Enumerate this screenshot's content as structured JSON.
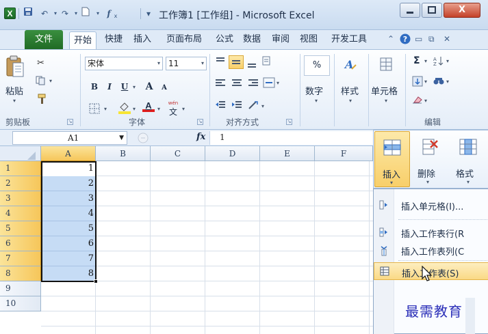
{
  "window": {
    "title": "工作簿1 [工作组] - Microsoft Excel",
    "close_glyph": "X"
  },
  "qat": {
    "app_icon": "X"
  },
  "tabs": [
    {
      "label": "文件"
    },
    {
      "label": "开始"
    },
    {
      "label": "快捷"
    },
    {
      "label": "插入"
    },
    {
      "label": "页面布局"
    },
    {
      "label": "公式"
    },
    {
      "label": "数据"
    },
    {
      "label": "审阅"
    },
    {
      "label": "视图"
    },
    {
      "label": "开发工具"
    }
  ],
  "ribbon": {
    "clipboard": {
      "paste_label": "粘贴",
      "group_label": "剪贴板"
    },
    "font": {
      "font_name": "宋体",
      "font_size": "11",
      "bold": "B",
      "italic": "I",
      "underline": "U",
      "grow": "A",
      "shrink": "A",
      "font_color_glyph": "A",
      "phonetic_glyph": "文",
      "group_label": "字体"
    },
    "alignment": {
      "group_label": "对齐方式"
    },
    "number": {
      "label": "数字"
    },
    "styles": {
      "label": "样式"
    },
    "cells": {
      "label": "单元格"
    },
    "editing": {
      "group_label": "编辑"
    },
    "launcher_glyph": "↘"
  },
  "formula_bar": {
    "name_box": "A1",
    "fx": "fx",
    "value": "1"
  },
  "sheet": {
    "columns": [
      "A",
      "B",
      "C",
      "D",
      "E",
      "F"
    ],
    "rows": [
      "1",
      "2",
      "3",
      "4",
      "5",
      "6",
      "7",
      "8",
      "9",
      "10"
    ],
    "values": [
      "1",
      "2",
      "3",
      "4",
      "5",
      "6",
      "7",
      "8"
    ]
  },
  "cells_group": {
    "insert_label": "插入",
    "delete_label": "删除",
    "format_label": "格式"
  },
  "insert_menu": {
    "items": [
      {
        "label": "插入单元格(I)..."
      },
      {
        "label": "插入工作表行(R"
      },
      {
        "label": "插入工作表列(C"
      },
      {
        "label": "插入工作表(S)"
      }
    ]
  },
  "watermark": "最需教育",
  "colors": {
    "accent_green": "#206b25",
    "selection_fill": "#c6dcf5",
    "highlight_orange": "#f8cf6a",
    "font_red": "#e02020",
    "fill_yellow": "#f7e534",
    "watermark_blue": "#2b2fb8"
  }
}
